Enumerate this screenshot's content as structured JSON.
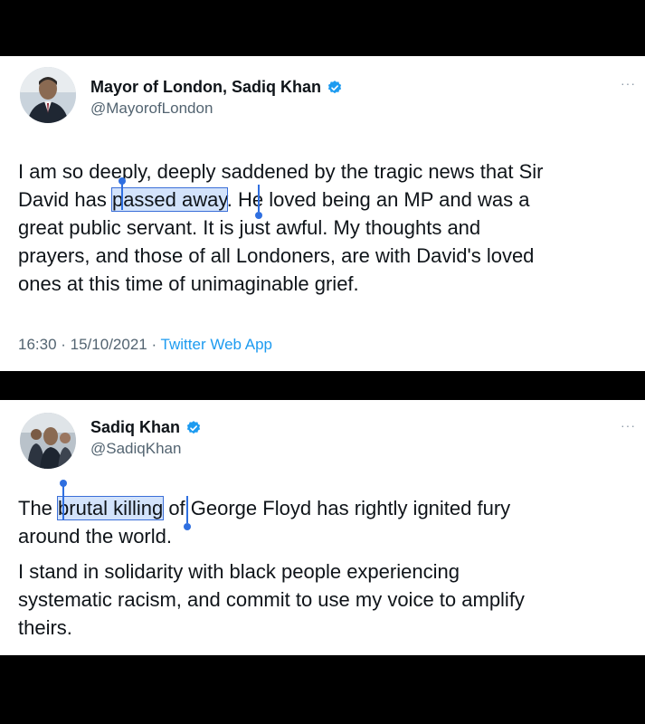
{
  "tweet1": {
    "display_name": "Mayor of London, Sadiq Khan",
    "handle": "@MayorofLondon",
    "more": "···",
    "lines": [
      "I am so deeply, deeply saddened by the tragic news that Sir",
      "David has ",
      "passed away",
      ". He loved being an MP and was a",
      "great public servant. It is just awful. My thoughts and",
      "prayers, and those of all Londoners, are with David's loved",
      "ones at this time of unimaginable grief."
    ],
    "time": "16:30 · 15/10/2021 · ",
    "app": "Twitter Web App",
    "icons": {
      "verified": "verified-badge-icon",
      "avatar": "avatar-photo"
    }
  },
  "tweet2": {
    "display_name": "Sadiq Khan",
    "handle": "@SadiqKhan",
    "more": "···",
    "para1": {
      "pre": "The ",
      "selected": "brutal killing",
      "post": " of George Floyd has rightly ignited fury",
      "line2": "around the world."
    },
    "para2": [
      "I stand in solidarity with black people experiencing",
      "systematic racism, and commit to use my voice to amplify",
      "theirs."
    ]
  },
  "colors": {
    "accent": "#1d9bf0",
    "selection": "#d3e3fb",
    "handle": "#2f6fe0"
  }
}
